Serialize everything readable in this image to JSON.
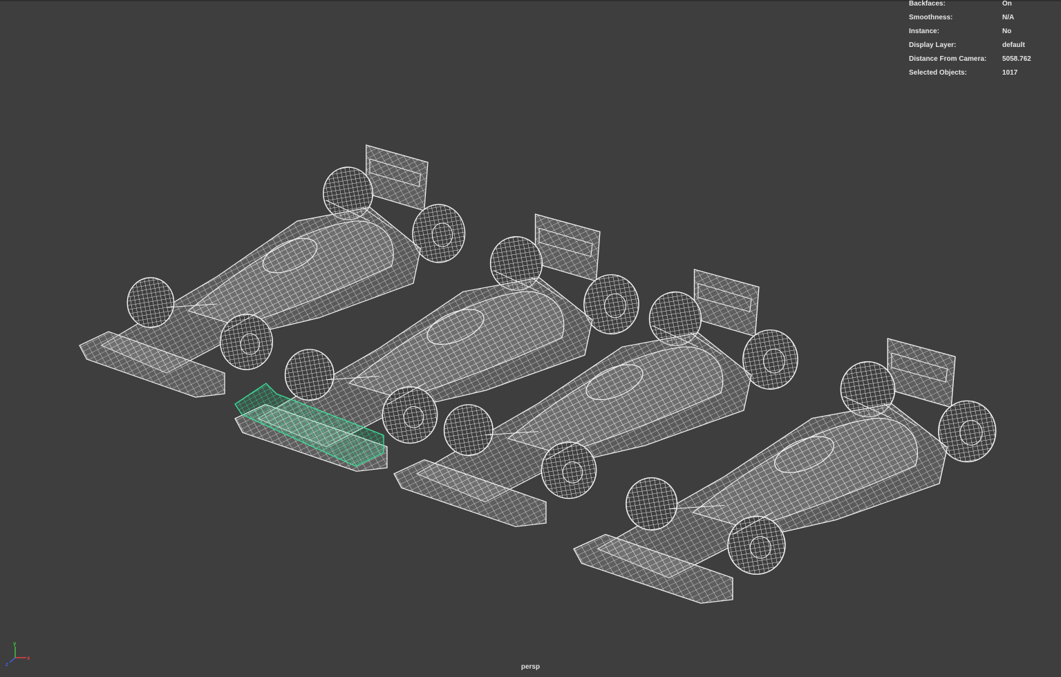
{
  "hud": {
    "rows": [
      {
        "label": "Backfaces:",
        "value": "On"
      },
      {
        "label": "Smoothness:",
        "value": "N/A"
      },
      {
        "label": "Instance:",
        "value": "No"
      },
      {
        "label": "Display Layer:",
        "value": "default"
      },
      {
        "label": "Distance From Camera:",
        "value": "5058.762"
      },
      {
        "label": "Selected Objects:",
        "value": "1017"
      }
    ]
  },
  "viewport": {
    "camera": "persp",
    "background_color": "#3e3e3e",
    "wire_color": "#f2f2f2",
    "selection_color": "#3ddc97"
  },
  "axis": {
    "x_label": "x",
    "y_label": "y",
    "z_label": "z",
    "x_color": "#e04040",
    "y_color": "#40c040",
    "z_color": "#4060e0"
  }
}
